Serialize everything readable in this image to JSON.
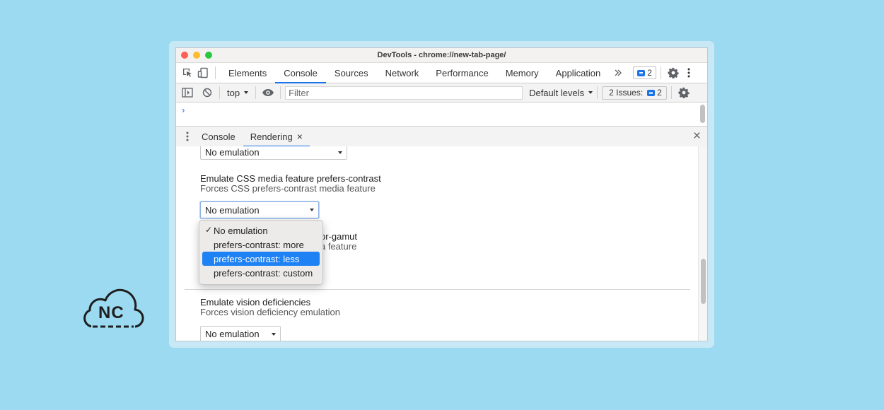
{
  "window": {
    "title": "DevTools - chrome://new-tab-page/"
  },
  "tabs": [
    {
      "label": "Elements"
    },
    {
      "label": "Console",
      "active": true
    },
    {
      "label": "Sources"
    },
    {
      "label": "Network"
    },
    {
      "label": "Performance"
    },
    {
      "label": "Memory"
    },
    {
      "label": "Application"
    }
  ],
  "tabbar": {
    "more_icon": "chevron-double-right-icon",
    "messages_count": "2"
  },
  "toolbar": {
    "context": "top",
    "filter_placeholder": "Filter",
    "levels": "Default levels",
    "issues_label": "2 Issues:",
    "issues_count": "2"
  },
  "console": {
    "prompt": "›"
  },
  "drawer": {
    "tabs": [
      {
        "label": "Console"
      },
      {
        "label": "Rendering",
        "active": true,
        "closable": true
      }
    ],
    "close_symbol": "×",
    "tab_close_symbol": "×"
  },
  "rendering": {
    "top_select_value": "No emulation",
    "contrast": {
      "title": "Emulate CSS media feature prefers-contrast",
      "subtitle": "Forces CSS prefers-contrast media feature",
      "value": "No emulation"
    },
    "color_gamut_fragments": {
      "title_end": "or-gamut",
      "subtitle_end": "a feature"
    },
    "vision": {
      "title": "Emulate vision deficiencies",
      "subtitle": "Forces vision deficiency emulation",
      "value": "No emulation"
    },
    "dropdown": {
      "options": [
        {
          "label": "No emulation",
          "checked": true
        },
        {
          "label": "prefers-contrast: more"
        },
        {
          "label": "prefers-contrast: less",
          "highlighted": true
        },
        {
          "label": "prefers-contrast: custom"
        }
      ],
      "check_symbol": "✓"
    }
  },
  "logo": {
    "text": "NC"
  },
  "colors": {
    "background": "#9bdaf0",
    "accent": "#1a73e8",
    "highlight": "#1f82f4"
  }
}
